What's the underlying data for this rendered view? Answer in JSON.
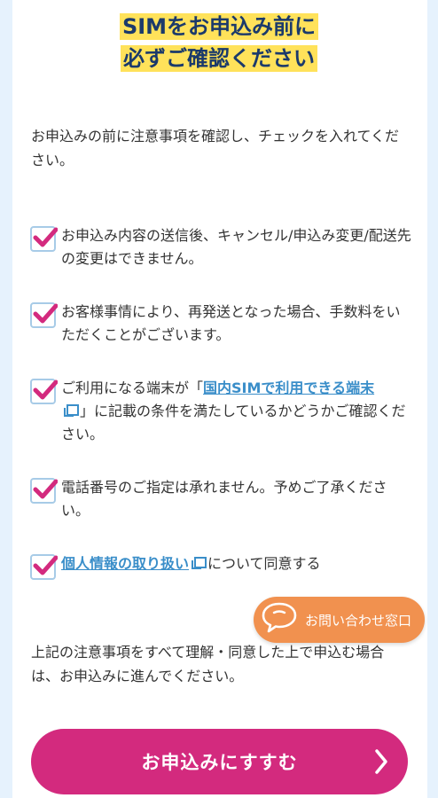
{
  "heading": {
    "line1": "SIMをお申込み前に",
    "line2": "必ずご確認ください"
  },
  "intro": "お申込みの前に注意事項を確認し、チェックを入れてください。",
  "checklist": [
    {
      "text": "お申込み内容の送信後、キャンセル/申込み変更/配送先の変更はできません。",
      "checked": true
    },
    {
      "text": "お客様事情により、再発送となった場合、手数料をいただくことがございます。",
      "checked": true
    },
    {
      "prefix": "ご利用になる端末が「",
      "link": "国内SIMで利用できる端末",
      "suffix": "」に記載の条件を満たしているかどうかご確認ください。",
      "checked": true
    },
    {
      "text": "電話番号のご指定は承れません。予めご了承ください。",
      "checked": true
    },
    {
      "link": "個人情報の取り扱い",
      "suffix": "について同意する",
      "checked": true
    }
  ],
  "contact": {
    "label": "お問い合わせ窓口",
    "icon": "chat-bubble-icon"
  },
  "outro": "上記の注意事項をすべて理解・同意した上で申込む場合は、お申込みに進んでください。",
  "apply": {
    "label": "お申込みにすすむ",
    "icon": "chevron-right-icon"
  },
  "colors": {
    "accent_pink": "#d32a7e",
    "check_pink": "#d32a7e",
    "link_blue": "#3a8ec9",
    "highlight_yellow": "#ffe25a",
    "contact_orange": "#f1914f",
    "page_bg": "#e6f2fd"
  }
}
